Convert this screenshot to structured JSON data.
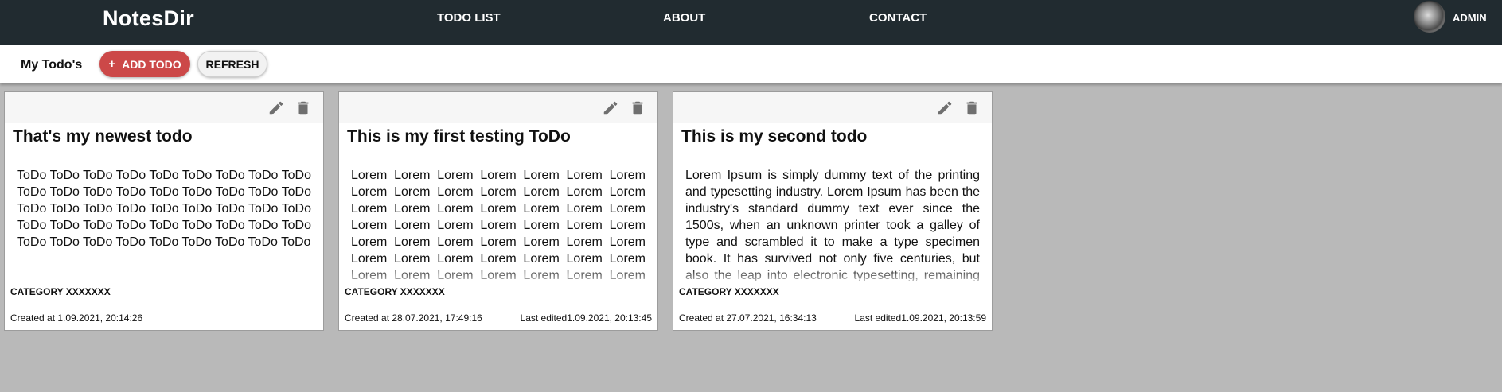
{
  "navbar": {
    "brand": "NotesDir",
    "links": [
      "TODO LIST",
      "ABOUT",
      "CONTACT"
    ],
    "user": {
      "name": "ADMIN",
      "avatar_icon": "user-avatar"
    }
  },
  "toolbar": {
    "title": "My Todo's",
    "add_icon": "+",
    "add_label": "ADD TODO",
    "refresh_label": "REFRESH"
  },
  "colors": {
    "navbar": "#212b30",
    "page_background": "#b9b9b9",
    "add_button": "#cc4848",
    "icon": "#6f6f6f"
  },
  "cards": [
    {
      "title": "That's my newest todo",
      "body": "ToDo ToDo ToDo ToDo ToDo ToDo ToDo ToDo ToDo ToDo ToDo ToDo ToDo ToDo ToDo ToDo ToDo ToDo ToDo ToDo ToDo ToDo ToDo ToDo ToDo ToDo ToDo ToDo ToDo ToDo ToDo ToDo ToDo ToDo ToDo ToDo ToDo ToDo ToDo ToDo ToDo ToDo ToDo ToDo ToDo",
      "category": "CATEGORY XXXXXXX",
      "created": "Created at 1.09.2021, 20:14:26",
      "edited": ""
    },
    {
      "title": "This is my first testing ToDo",
      "body": "Lorem Lorem Lorem Lorem Lorem Lorem Lorem Lorem Lorem Lorem Lorem Lorem Lorem Lorem Lorem Lorem Lorem Lorem Lorem Lorem Lorem Lorem Lorem Lorem Lorem Lorem Lorem Lorem Lorem Lorem Lorem Lorem Lorem Lorem Lorem Lorem Lorem Lorem Lorem Lorem Lorem Lorem Lorem Lorem Lorem Lorem Lorem Lorem Lorem Lorem Lorem Lorem Lorem Lorem Lorem Lorem",
      "category": "CATEGORY XXXXXXX",
      "created": "Created at 28.07.2021, 17:49:16",
      "edited": "Last edited1.09.2021, 20:13:45"
    },
    {
      "title": "This is my second todo",
      "body": "Lorem Ipsum is simply dummy text of the printing and typesetting industry. Lorem Ipsum has been the industry's standard dummy text ever since the 1500s, when an unknown printer took a galley of type and scrambled it to make a type specimen book. It has survived not only five centuries, but also the leap into electronic typesetting, remaining essentially unchanged. It was popularised in the",
      "category": "CATEGORY XXXXXXX",
      "created": "Created at 27.07.2021, 16:34:13",
      "edited": "Last edited1.09.2021, 20:13:59"
    }
  ]
}
